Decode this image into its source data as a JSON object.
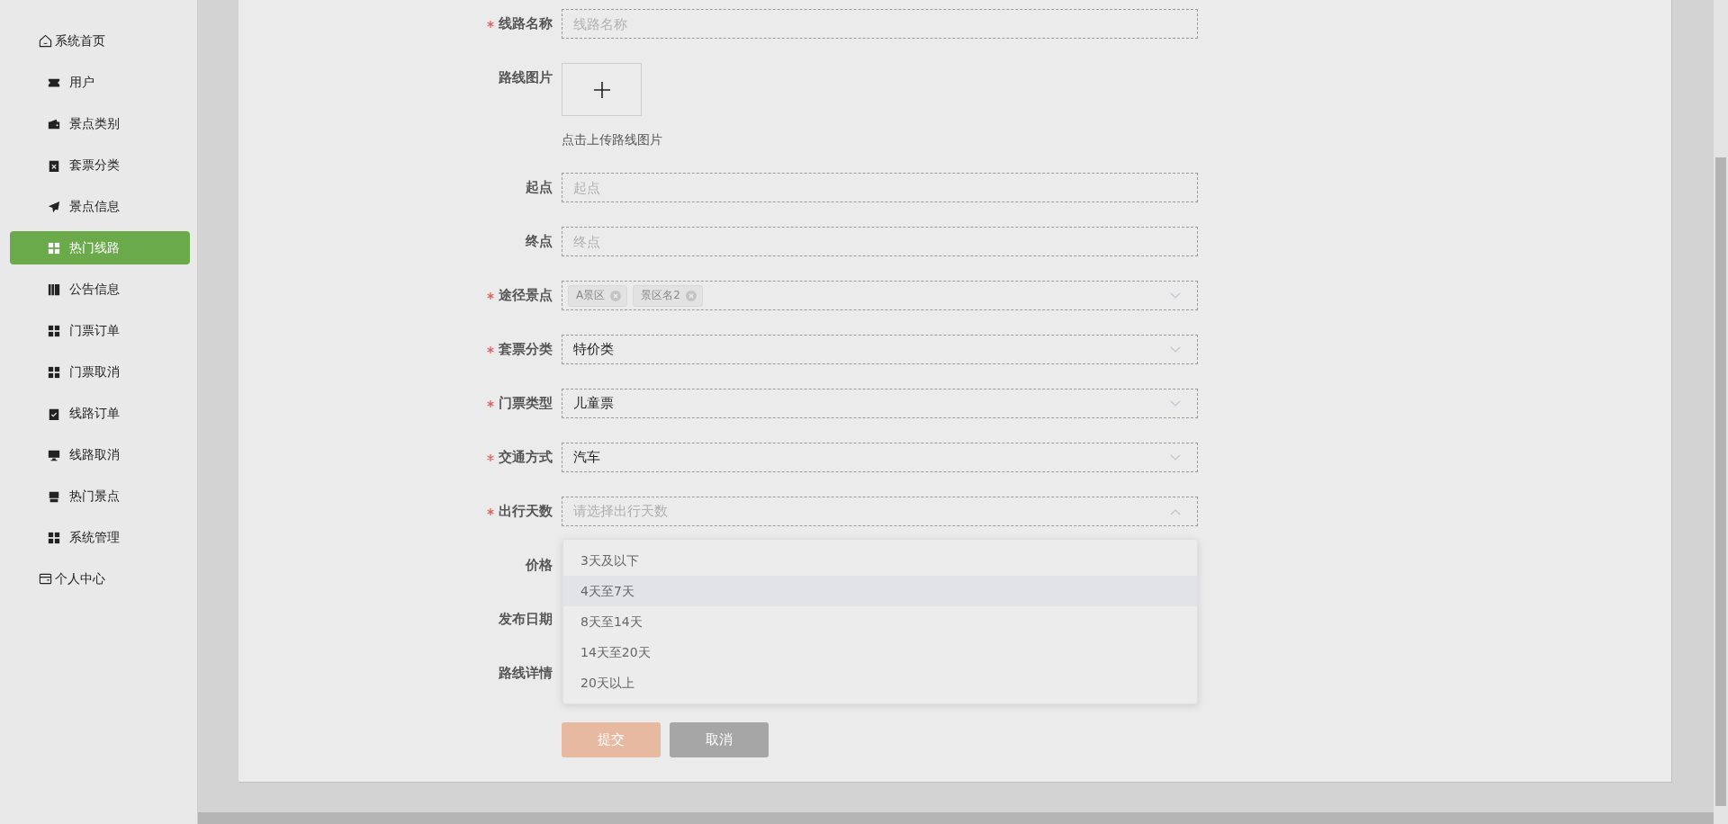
{
  "sidebar": {
    "items": [
      {
        "label": "系统首页",
        "kind": "section",
        "selected": false
      },
      {
        "label": "用户",
        "kind": "item",
        "selected": false
      },
      {
        "label": "景点类别",
        "kind": "item",
        "selected": false
      },
      {
        "label": "套票分类",
        "kind": "item",
        "selected": false
      },
      {
        "label": "景点信息",
        "kind": "item",
        "selected": false
      },
      {
        "label": "热门线路",
        "kind": "item",
        "selected": true
      },
      {
        "label": "公告信息",
        "kind": "item",
        "selected": false
      },
      {
        "label": "门票订单",
        "kind": "item",
        "selected": false
      },
      {
        "label": "门票取消",
        "kind": "item",
        "selected": false
      },
      {
        "label": "线路订单",
        "kind": "item",
        "selected": false
      },
      {
        "label": "线路取消",
        "kind": "item",
        "selected": false
      },
      {
        "label": "热门景点",
        "kind": "item",
        "selected": false
      },
      {
        "label": "系统管理",
        "kind": "item",
        "selected": false
      },
      {
        "label": "个人中心",
        "kind": "section",
        "selected": false
      }
    ]
  },
  "form": {
    "fields": [
      {
        "label": "线路名称",
        "kind": "text",
        "required": true,
        "placeholder": "线路名称"
      },
      {
        "label": "路线图片",
        "kind": "upload",
        "required": false,
        "hint": "点击上传路线图片"
      },
      {
        "label": "起点",
        "kind": "text",
        "required": false,
        "placeholder": "起点"
      },
      {
        "label": "终点",
        "kind": "text",
        "required": false,
        "placeholder": "终点"
      },
      {
        "label": "途径景点",
        "kind": "tags",
        "required": true,
        "tags": [
          "A景区",
          "景区名2"
        ]
      },
      {
        "label": "套票分类",
        "kind": "select",
        "required": true,
        "value": "特价类",
        "open": false
      },
      {
        "label": "门票类型",
        "kind": "select",
        "required": true,
        "value": "儿童票",
        "open": false
      },
      {
        "label": "交通方式",
        "kind": "select",
        "required": true,
        "value": "汽车",
        "open": false
      },
      {
        "label": "出行天数",
        "kind": "select",
        "required": true,
        "placeholder": "请选择出行天数",
        "open": true,
        "options": [
          {
            "label": "3天及以下",
            "hovered": false
          },
          {
            "label": "4天至7天",
            "hovered": true
          },
          {
            "label": "8天至14天",
            "hovered": false
          },
          {
            "label": "14天至20天",
            "hovered": false
          },
          {
            "label": "20天以上",
            "hovered": false
          }
        ]
      },
      {
        "label": "价格",
        "kind": "covered",
        "required": false
      },
      {
        "label": "发布日期",
        "kind": "covered",
        "required": false
      },
      {
        "label": "路线详情",
        "kind": "covered",
        "required": false
      }
    ],
    "buttons": [
      {
        "label": "提交",
        "kind": "submit"
      },
      {
        "label": "取消",
        "kind": "cancel"
      }
    ]
  }
}
